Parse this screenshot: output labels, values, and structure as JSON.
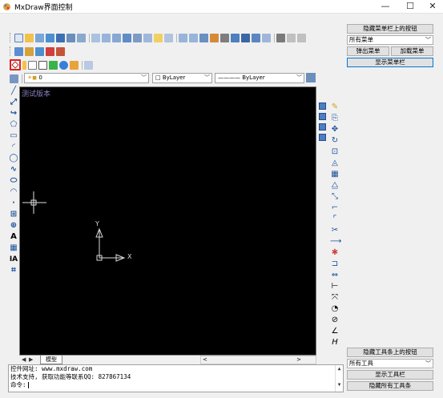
{
  "window": {
    "title": "MxDraw界面控制",
    "minimize": "—",
    "maximize": "☐",
    "close": "✕"
  },
  "layer_bar": {
    "layer_value": "0",
    "color_value": "ByLayer",
    "linetype_value": "ByLayer"
  },
  "canvas": {
    "watermark": "测试版本",
    "axis_x": "X",
    "axis_y": "Y",
    "background": "#000000"
  },
  "tabs": {
    "model": "模型",
    "nav_prev": "◀",
    "nav_next": "▶",
    "hscroll_left": "<",
    "hscroll_right": ">"
  },
  "command": {
    "line1": "控件网址: www.mxdraw.com",
    "line2": "技术支持, 获取功能等联系QQ: 827867134",
    "prompt": "命令:"
  },
  "right_panel": {
    "hide_menubar_buttons": "隐藏菜单栏上的按钮",
    "all_menus": "所有菜单",
    "popup_menu": "弹出菜单",
    "load_menu": "加载菜单",
    "show_menubar": "显示菜单栏",
    "hide_toolbar_buttons": "隐藏工具条上的按钮",
    "all_tools": "所有工具",
    "show_toolbar": "显示工具栏",
    "hide_all_toolbars": "隐藏所有工具条"
  },
  "colors": {
    "accent": "#0078d7",
    "icon_blue": "#1a4f9a",
    "watermark": "#8a7fc0",
    "highlight_red": "#e02020"
  }
}
